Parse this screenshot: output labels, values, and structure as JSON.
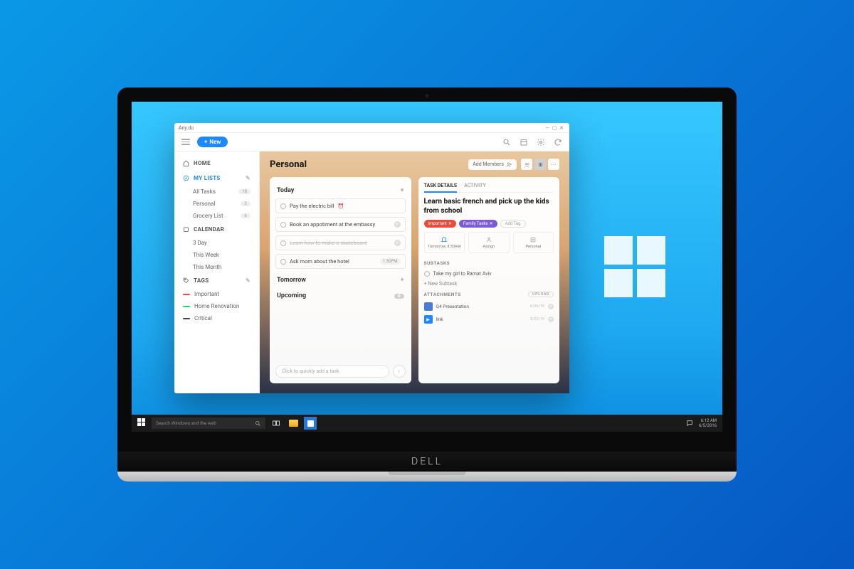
{
  "app": {
    "title": "Any.do"
  },
  "toolbar": {
    "new_label": "New"
  },
  "sidebar": {
    "home": "HOME",
    "mylists": "MY LISTS",
    "calendar": "CALENDAR",
    "tags": "TAGS",
    "lists": [
      {
        "label": "All Tasks",
        "count": "18"
      },
      {
        "label": "Personal",
        "count": "2"
      },
      {
        "label": "Grocery List",
        "count": "6"
      }
    ],
    "cal": [
      {
        "label": "3 Day"
      },
      {
        "label": "This Week"
      },
      {
        "label": "This Month"
      }
    ],
    "tag_items": [
      {
        "label": "Important",
        "color": "#e74c3c"
      },
      {
        "label": "Home Renovation",
        "color": "#2ecc71"
      },
      {
        "label": "Critical",
        "color": "#34495e"
      }
    ]
  },
  "page": {
    "title": "Personal",
    "add_members": "Add Members"
  },
  "groups": {
    "today": "Today",
    "tomorrow": "Tomorrow",
    "upcoming": "Upcoming",
    "upcoming_count": "0"
  },
  "tasks": {
    "today": [
      {
        "label": "Pay the electric bill",
        "clock": true
      },
      {
        "label": "Book an appotiment at the embassy",
        "x": true
      },
      {
        "label": "Learn how to make a skateboard",
        "done": true,
        "x": true
      },
      {
        "label": "Ask mom about the hotel",
        "meta": "1:30PM"
      }
    ]
  },
  "quickadd": {
    "placeholder": "Click to quickly add a task"
  },
  "detail": {
    "tabs": {
      "task": "TASK DETAILS",
      "activity": "ACTIVITY"
    },
    "title": "Learn basic french and pick up the kids from school",
    "tags": [
      {
        "label": "Important",
        "color": "#e74c3c"
      },
      {
        "label": "Family Tasks",
        "color": "#7b5bd6"
      }
    ],
    "add_tag": "Add Tag",
    "actions": {
      "remind": "Tomorrow, 8:30AM",
      "assign": "Assign",
      "list": "Personal"
    },
    "subtasks_head": "SUBTASKS",
    "subtask1": "Take my girl to Ramat Aviv",
    "new_subtask": "+ New Subtask",
    "attachments_head": "ATTACHMENTS",
    "upload": "UPLOAD",
    "attachments": [
      {
        "label": "Q4 Presentation",
        "date": "6/26/19",
        "color": "#4a7bd6"
      },
      {
        "label": "link",
        "date": "5/22/19",
        "color": "#1e88ff"
      }
    ]
  },
  "taskbar": {
    "search_placeholder": "Search Windows and the web",
    "time": "6:12 AM",
    "date": "6/5/2016"
  },
  "laptop_brand": "DELL"
}
